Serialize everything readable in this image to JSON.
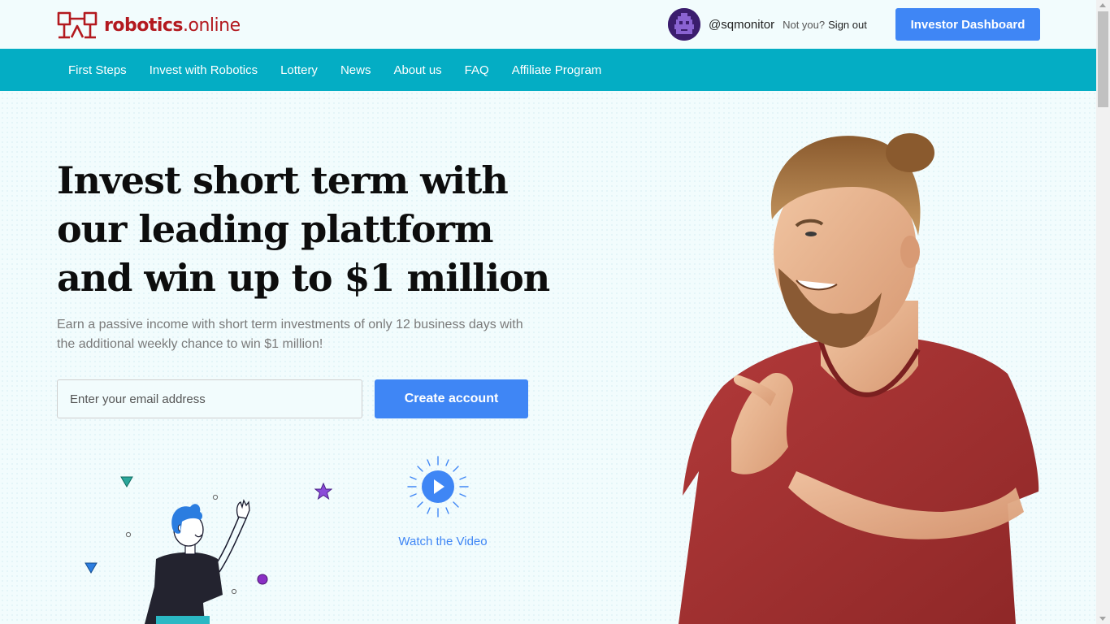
{
  "header": {
    "logo_text_bold": "robotics",
    "logo_text_rest": ".online",
    "username": "@sqmonitor",
    "not_you": "Not you?",
    "sign_out": "Sign out",
    "dashboard_button": "Investor Dashboard"
  },
  "nav": {
    "items": [
      "First Steps",
      "Invest with Robotics",
      "Lottery",
      "News",
      "About us",
      "FAQ",
      "Affiliate Program"
    ]
  },
  "hero": {
    "headline_line1": "Invest short term with",
    "headline_line2": "our leading plattform",
    "headline_line3": "and win up to $1 million",
    "subtext": "Earn a passive income with short term investments of only 12 business days with the additional weekly chance to win $1 million!",
    "email_placeholder": "Enter your email address",
    "create_button": "Create account",
    "video_link": "Watch the Video"
  },
  "colors": {
    "accent_blue": "#3f86f5",
    "nav_teal": "#04adc4",
    "brand_red": "#b3191f",
    "background": "#f2fcfd"
  }
}
